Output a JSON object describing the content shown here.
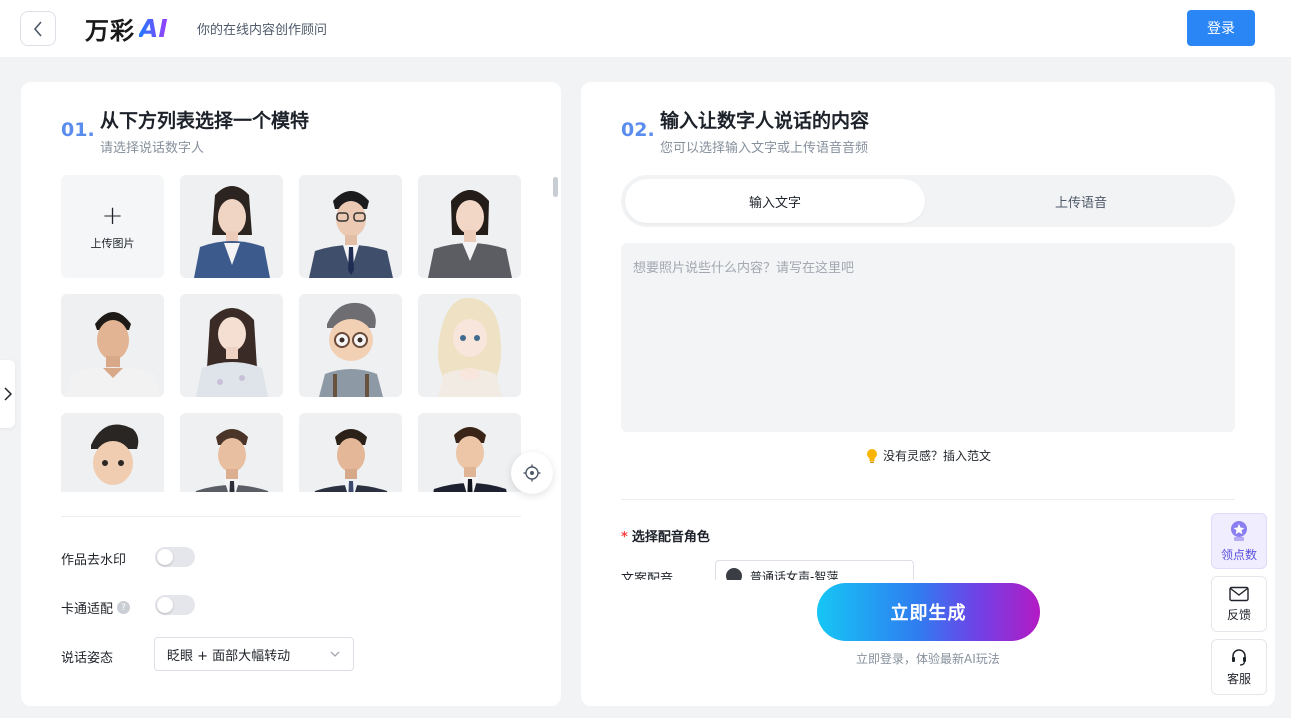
{
  "header": {
    "logo_text": "万彩",
    "logo_ai": "AI",
    "slogan": "你的在线内容创作顾问",
    "login_label": "登录"
  },
  "step1": {
    "num": "01.",
    "title": "从下方列表选择一个模特",
    "subtitle": "请选择说话数字人",
    "upload_label": "上传图片"
  },
  "options": {
    "watermark_label": "作品去水印",
    "cartoon_label": "卡通适配",
    "pose_label": "说话姿态",
    "pose_value": "眨眼 + 面部大幅转动"
  },
  "step2": {
    "num": "02.",
    "title": "输入让数字人说话的内容",
    "subtitle": "您可以选择输入文字或上传语音音频",
    "tab_text": "输入文字",
    "tab_audio": "上传语音",
    "textarea_placeholder": "想要照片说些什么内容？请写在这里吧",
    "inspire_text": "没有灵感？插入范文",
    "voice_title": "选择配音角色",
    "voice_row_label": "文案配音",
    "voice_value": "普通话女声-智萍",
    "generate_label": "立即生成",
    "generate_hint": "立即登录，体验最新AI玩法"
  },
  "float_tools": {
    "points": "领点数",
    "feedback": "反馈",
    "service": "客服"
  },
  "colors": {
    "accent": "#2b86f5",
    "step_num": "#5b8def",
    "required": "#f53f3f"
  },
  "models": [
    {
      "type": "woman-suit-navy"
    },
    {
      "type": "man-glasses-suit"
    },
    {
      "type": "woman-suit-gray"
    },
    {
      "type": "man-tshirt"
    },
    {
      "type": "woman-blouse"
    },
    {
      "type": "cartoon-boy-glasses"
    },
    {
      "type": "cartoon-girl-blonde"
    },
    {
      "type": "cartoon-boy"
    },
    {
      "type": "man-suit-1"
    },
    {
      "type": "man-suit-2"
    },
    {
      "type": "man-suit-3"
    }
  ]
}
